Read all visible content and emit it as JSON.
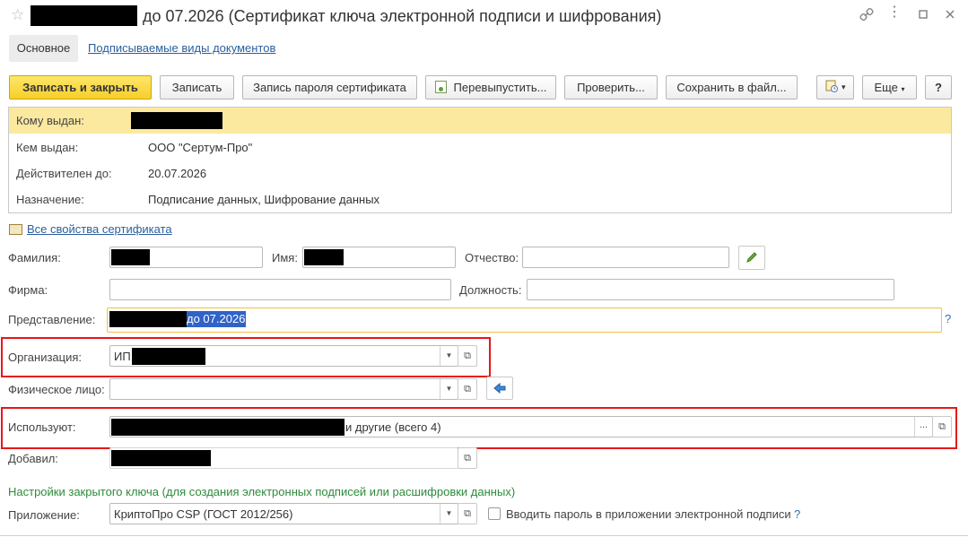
{
  "window": {
    "title_suffix": "до 07.2026 (Сертификат ключа электронной подписи и шифрования)",
    "icons": [
      "star-icon",
      "link-icon",
      "more-icon",
      "restore-icon",
      "close-icon"
    ]
  },
  "tabs": [
    {
      "label": "Основное",
      "active": true
    },
    {
      "label": "Подписываемые виды документов",
      "active": false
    }
  ],
  "toolbar": {
    "save_close": "Записать и закрыть",
    "save": "Записать",
    "password": "Запись пароля сертификата",
    "reissue": "Перевыпустить...",
    "check": "Проверить...",
    "save_file": "Сохранить в файл...",
    "more": "Еще",
    "help": "?"
  },
  "cert": {
    "issued_to_label": "Кому выдан:",
    "issued_by_label": "Кем выдан:",
    "issued_by": "ООО \"Сертум-Про\"",
    "valid_until_label": "Действителен до:",
    "valid_until": "20.07.2026",
    "purpose_label": "Назначение:",
    "purpose": "Подписание данных, Шифрование данных"
  },
  "all_props_link": "Все свойства сертификата",
  "form": {
    "lastname_label": "Фамилия:",
    "firstname_label": "Имя:",
    "patronymic_label": "Отчество:",
    "firm_label": "Фирма:",
    "position_label": "Должность:",
    "representation_label": "Представление:",
    "representation_value": " до 07.2026",
    "organization_label": "Организация:",
    "organization_prefix": "ИП",
    "person_label": "Физическое лицо:",
    "users_label": "Используют:",
    "users_suffix": "и другие (всего 4)",
    "added_label": "Добавил:",
    "help_q": "?"
  },
  "private_key": {
    "title": "Настройки закрытого ключа (для создания электронных подписей или расшифровки данных)",
    "app_label": "Приложение:",
    "app_value": "КриптоПро CSP (ГОСТ 2012/256)",
    "enter_password_label": "Вводить пароль в приложении электронной подписи",
    "help_q": "?"
  },
  "colors": {
    "highlight_red": "#e8161b",
    "primary_button": "#f7cf2a",
    "cert_header": "#fbe9a0",
    "link": "#2a5f9e",
    "section_green": "#2e8b3a",
    "focus_border": "#f0c040"
  }
}
